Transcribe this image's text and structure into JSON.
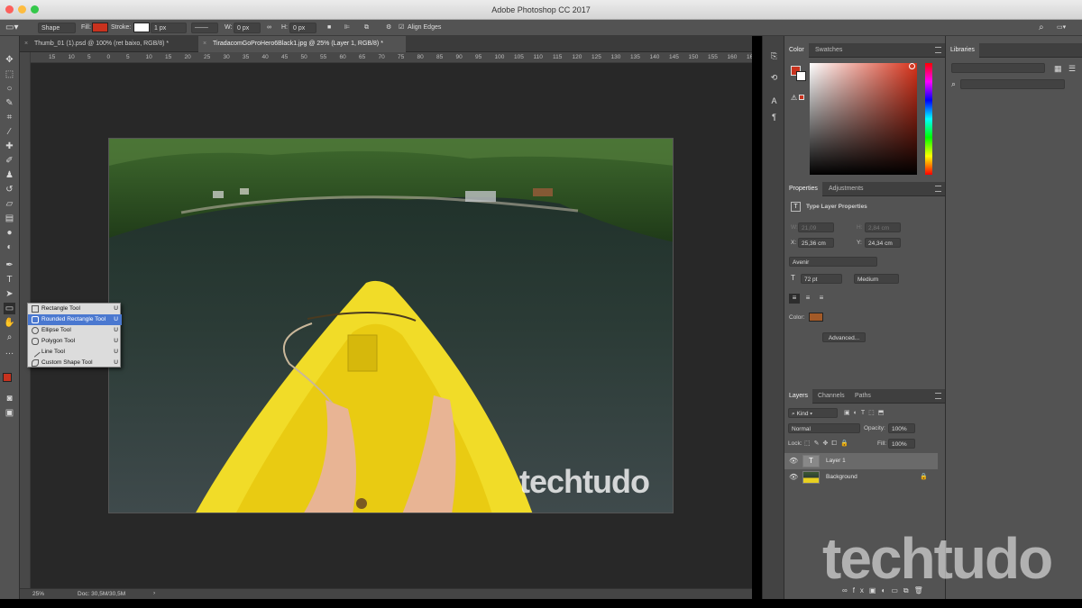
{
  "app": {
    "title": "Adobe Photoshop CC 2017"
  },
  "options_bar": {
    "mode": "Shape",
    "fill_label": "Fill:",
    "fill_color": "#c8321e",
    "stroke_label": "Stroke:",
    "stroke_width": "1 px",
    "w_label": "W:",
    "w_value": "0 px",
    "h_label": "H:",
    "h_value": "0 px",
    "align_edges_label": "Align Edges"
  },
  "doc_tabs": [
    {
      "label": "Thumb_01 (1).psd @ 100% (ret baixo, RGB/8) *"
    },
    {
      "label": "TiradacomGoProHero6Black1.jpg @ 25% (Layer 1, RGB/8) *"
    }
  ],
  "ruler_ticks": [
    "15",
    "10",
    "5",
    "0",
    "5",
    "10",
    "15",
    "20",
    "25",
    "30",
    "35",
    "40",
    "45",
    "50",
    "55",
    "60",
    "65",
    "70",
    "75",
    "80",
    "85",
    "90",
    "95",
    "100",
    "105",
    "110",
    "115",
    "120",
    "125",
    "130",
    "135",
    "140",
    "145",
    "150",
    "155",
    "160",
    "165"
  ],
  "flyout": {
    "items": [
      {
        "label": "Rectangle Tool",
        "key": "U"
      },
      {
        "label": "Rounded Rectangle Tool",
        "key": "U"
      },
      {
        "label": "Ellipse Tool",
        "key": "U"
      },
      {
        "label": "Polygon Tool",
        "key": "U"
      },
      {
        "label": "Line Tool",
        "key": "U"
      },
      {
        "label": "Custom Shape Tool",
        "key": "U"
      }
    ]
  },
  "status": {
    "zoom": "25%",
    "doc": "Doc: 30,5M/30,5M"
  },
  "photo_watermark": "techtudo",
  "big_watermark": "techtudo",
  "color_panel": {
    "tabs": [
      "Color",
      "Swatches"
    ],
    "foreground": "#c8321e",
    "background": "#ffffff"
  },
  "properties_panel": {
    "tabs": [
      "Properties",
      "Adjustments"
    ],
    "section_title": "Type Layer Properties",
    "w_label": "W:",
    "w_value": "21,09",
    "h_label": "H:",
    "h_value": "2,84 cm",
    "x_label": "X:",
    "x_value": "25,36 cm",
    "y_label": "Y:",
    "y_value": "24,34 cm",
    "font": "Avenir",
    "size": "72 pt",
    "weight": "Medium",
    "color_label": "Color:",
    "color_value": "#a35a28",
    "advanced_button": "Advanced..."
  },
  "layers_panel": {
    "tabs": [
      "Layers",
      "Channels",
      "Paths"
    ],
    "filter": "Kind",
    "blend_mode": "Normal",
    "opacity_label": "Opacity:",
    "opacity": "100%",
    "lock_label": "Lock:",
    "fill_label": "Fill:",
    "fill": "100%",
    "layers": [
      {
        "name": "Layer 1",
        "type": "text"
      },
      {
        "name": "Background",
        "type": "image"
      }
    ]
  },
  "libraries_panel": {
    "tab": "Libraries"
  }
}
